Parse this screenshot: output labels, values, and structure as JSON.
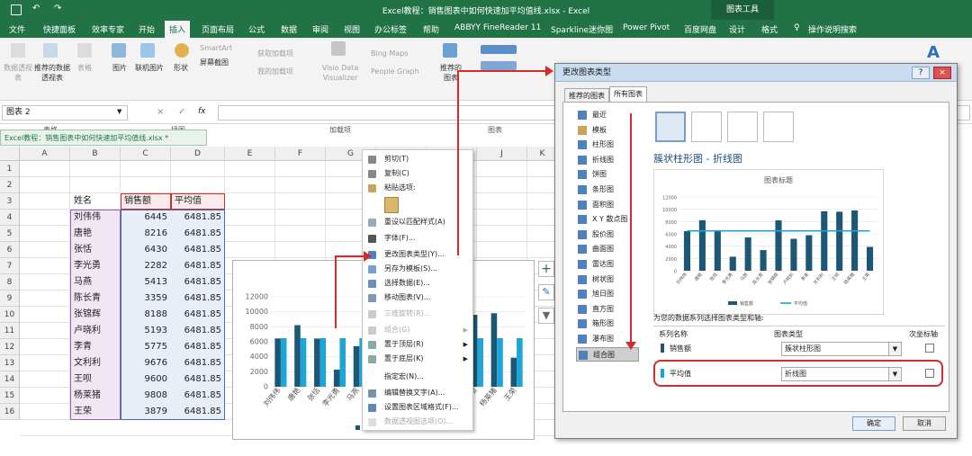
{
  "window": {
    "title": "Excel教程：销售图表中如何快速加平均值线.xlsx - Excel",
    "context_tab": "图表工具",
    "colors": {
      "accent": "#217346",
      "bar_dark": "#1c5775",
      "bar_light": "#1ea5d8",
      "line": "#25a0cf",
      "highlight": "#d22c2c"
    }
  },
  "menu_tabs": [
    "文件",
    "快捷面板",
    "效率专家",
    "开始",
    "插入",
    "页面布局",
    "公式",
    "数据",
    "审阅",
    "视图",
    "办公标签",
    "帮助",
    "ABBYY FineReader 11",
    "Sparkline迷你图",
    "Power Pivot",
    "百度网盘",
    "设计",
    "格式",
    "操作说明搜索"
  ],
  "ribbon": {
    "items": [
      "数据透视表",
      "推荐的数据透视表",
      "表格",
      "图片",
      "联机图片",
      "形状",
      "SmartArt",
      "屏幕截图",
      "获取加载项",
      "我的加载项",
      "Visio Data Visualizer",
      "Bing Maps",
      "People Graph",
      "推荐的图表"
    ],
    "groups": [
      "表格",
      "插图",
      "加载项",
      "图表"
    ]
  },
  "namebox": "图表 2",
  "fx": "fx",
  "doc_tab": "Excel教程：销售图表中如何快速加平均值线.xlsx *",
  "columns": [
    "A",
    "B",
    "C",
    "D",
    "E",
    "F",
    "G",
    "H",
    "I",
    "J",
    "K"
  ],
  "rows": [
    "1",
    "2",
    "3",
    "4",
    "5",
    "6",
    "7",
    "8",
    "9",
    "10",
    "11",
    "12",
    "13",
    "14",
    "15",
    "16"
  ],
  "table": {
    "headers": [
      "姓名",
      "销售额",
      "平均值"
    ],
    "rows": [
      [
        "刘伟伟",
        "6445",
        "6481.85"
      ],
      [
        "唐艳",
        "8216",
        "6481.85"
      ],
      [
        "张恬",
        "6430",
        "6481.85"
      ],
      [
        "李光勇",
        "2282",
        "6481.85"
      ],
      [
        "马燕",
        "5413",
        "6481.85"
      ],
      [
        "陈长青",
        "3359",
        "6481.85"
      ],
      [
        "张锦辉",
        "8188",
        "6481.85"
      ],
      [
        "卢晓利",
        "5193",
        "6481.85"
      ],
      [
        "李青",
        "5775",
        "6481.85"
      ],
      [
        "文利利",
        "9676",
        "6481.85"
      ],
      [
        "王呗",
        "9600",
        "6481.85"
      ],
      [
        "杨莱猪",
        "9808",
        "6481.85"
      ],
      [
        "王荣",
        "3879",
        "6481.85"
      ]
    ]
  },
  "context_menu": [
    "剪切(T)",
    "复制(C)",
    "粘贴选项:",
    "重设以匹配样式(A)",
    "字体(F)...",
    "更改图表类型(Y)...",
    "另存为模板(S)...",
    "选择数据(E)...",
    "移动图表(V)...",
    "三维旋转(R)...",
    "组合(G)",
    "置于顶层(R)",
    "置于底层(K)",
    "指定宏(N)...",
    "编辑替换文字(A)...",
    "设置图表区域格式(F)...",
    "数据透视图选项(O)..."
  ],
  "chart_data": [
    {
      "type": "bar",
      "categories": [
        "刘伟伟",
        "唐艳",
        "张恬",
        "李光勇",
        "马燕",
        "陈长青",
        "张锦辉",
        "卢晓利",
        "李青",
        "文利利",
        "王呗",
        "杨莱猪",
        "王荣"
      ],
      "series": [
        {
          "name": "销售额",
          "values": [
            6445,
            8216,
            6430,
            2282,
            5413,
            3359,
            8188,
            5193,
            5775,
            9676,
            9600,
            9808,
            3879
          ]
        },
        {
          "name": "平均值",
          "values": [
            6481.85,
            6481.85,
            6481.85,
            6481.85,
            6481.85,
            6481.85,
            6481.85,
            6481.85,
            6481.85,
            6481.85,
            6481.85,
            6481.85,
            6481.85
          ]
        }
      ],
      "yticks": [
        "0",
        "2000",
        "4000",
        "6000",
        "8000",
        "10000",
        "12000"
      ],
      "ylim": [
        0,
        12000
      ],
      "legend": "销"
    },
    {
      "type": "bar",
      "title": "图表标题",
      "categories": [
        "刘伟伟",
        "唐艳",
        "张恬",
        "李光勇",
        "马燕",
        "陈长青",
        "张锦辉",
        "卢晓利",
        "李青",
        "文利利",
        "王呗",
        "杨莱猪",
        "王荣"
      ],
      "series": [
        {
          "name": "销售额",
          "values": [
            6445,
            8216,
            6430,
            2282,
            5413,
            3359,
            8188,
            5193,
            5775,
            9676,
            9600,
            9808,
            3879
          ]
        },
        {
          "name": "平均值",
          "values": [
            6481.85,
            6481.85,
            6481.85,
            6481.85,
            6481.85,
            6481.85,
            6481.85,
            6481.85,
            6481.85,
            6481.85,
            6481.85,
            6481.85,
            6481.85
          ]
        }
      ],
      "yticks": [
        "0",
        "2000",
        "4000",
        "6000",
        "8000",
        "10000",
        "12000"
      ],
      "ylim": [
        0,
        12000
      ],
      "legend_position": "bottom"
    }
  ],
  "dialog": {
    "title": "更改图表类型",
    "tabs": [
      "推荐的图表",
      "所有图表"
    ],
    "types": [
      "最近",
      "模板",
      "柱形图",
      "折线图",
      "饼图",
      "条形图",
      "面积图",
      "X Y 散点图",
      "股价图",
      "曲面图",
      "雷达图",
      "树状图",
      "旭日图",
      "直方图",
      "箱形图",
      "瀑布图",
      "组合图"
    ],
    "heading": "簇状柱形图 - 折线图",
    "series_prompt": "为您的数据系列选择图表类型和轴:",
    "col_headers": [
      "系列名称",
      "图表类型",
      "次坐标轴"
    ],
    "series": [
      {
        "name": "销售额",
        "type": "簇状柱形图"
      },
      {
        "name": "平均值",
        "type": "折线图"
      }
    ],
    "ok": "确定",
    "cancel": "取消"
  },
  "close_glyph": "×",
  "help_glyph": "?",
  "dropdown_glyph": "▼"
}
